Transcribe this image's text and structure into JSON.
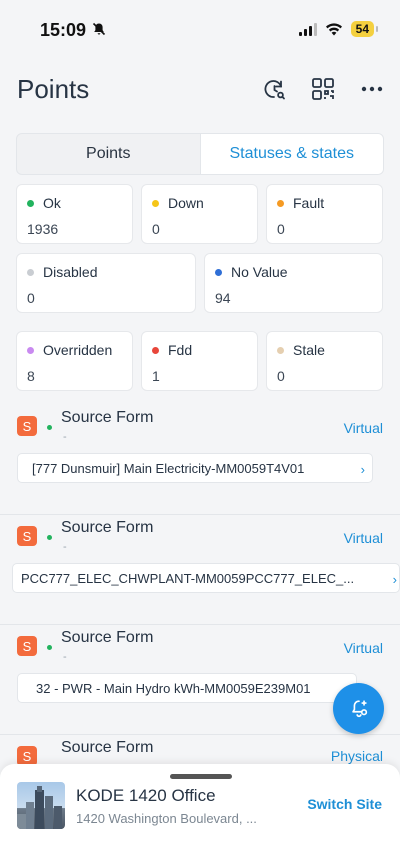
{
  "status_bar": {
    "time": "15:09",
    "battery": "54"
  },
  "header": {
    "title": "Points"
  },
  "tabs": [
    {
      "label": "Points",
      "active": false
    },
    {
      "label": "Statuses & states",
      "active": true
    }
  ],
  "statuses": [
    {
      "label": "Ok",
      "value": "1936",
      "color": "#22b35e"
    },
    {
      "label": "Down",
      "value": "0",
      "color": "#f5c518"
    },
    {
      "label": "Fault",
      "value": "0",
      "color": "#f59a23"
    },
    {
      "label": "Disabled",
      "value": "0",
      "color": "#c9cdd2"
    },
    {
      "label": "No Value",
      "value": "94",
      "color": "#2f6fd6"
    },
    {
      "label": "Overridden",
      "value": "8",
      "color": "#c98af0"
    },
    {
      "label": "Fdd",
      "value": "1",
      "color": "#e8463a"
    },
    {
      "label": "Stale",
      "value": "0",
      "color": "#e5cfb0"
    }
  ],
  "items": [
    {
      "badge": "S",
      "title": "Source Form",
      "subtitle": "-",
      "type": "Virtual",
      "point": "[777 Dunsmuir] Main Electricity-MM0059T4V01"
    },
    {
      "badge": "S",
      "title": "Source Form",
      "subtitle": "-",
      "type": "Virtual",
      "point": "PCC777_ELEC_CHWPLANT-MM0059PCC777_ELEC_..."
    },
    {
      "badge": "S",
      "title": "Source Form",
      "subtitle": "-",
      "type": "Virtual",
      "point": "32 - PWR -  Main Hydro kWh-MM0059E239M01"
    },
    {
      "badge": "S",
      "title": "Source Form",
      "subtitle": "",
      "type": "Physical",
      "point": ""
    }
  ],
  "site": {
    "name": "KODE 1420 Office",
    "address": "1420 Washington Boulevard, ...",
    "switch_label": "Switch Site"
  },
  "colors": {
    "accent": "#1e8fd6",
    "badge": "#f36b3d"
  }
}
